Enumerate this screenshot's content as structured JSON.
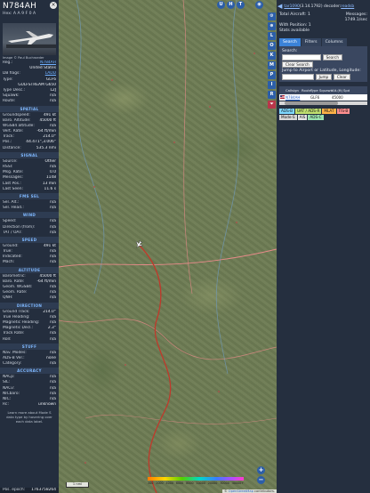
{
  "aircraft": {
    "callsign": "N784AH",
    "hex_line": "Hex: A A 9 F 0 A",
    "close_glyph": "×",
    "photo_credit": "Image © Paul Buchroeder",
    "identity": [
      {
        "k": "Reg.:",
        "v": "N784AH",
        "link": true
      },
      {
        "k": "",
        "v": "United States",
        "link": false
      },
      {
        "k": "DB flags:",
        "v": "LADD",
        "link": true
      },
      {
        "k": "Type:",
        "v": "GLF6",
        "link": false
      },
      {
        "k": "",
        "v": "GULFSTREAM G650",
        "link": false
      },
      {
        "k": "Type Desc.:",
        "v": "L2J",
        "link": false
      },
      {
        "k": "Squawk:",
        "v": "n/a",
        "link": false
      },
      {
        "k": "Route:",
        "v": "n/a",
        "link": false
      }
    ],
    "sections": [
      {
        "title": "SPATIAL",
        "rows": [
          {
            "k": "Groundspeed:",
            "v": "491 kt"
          },
          {
            "k": "Baro. Altitude:",
            "v": "45000 ft"
          },
          {
            "k": "WGS84 altitude:",
            "v": "n/a"
          },
          {
            "k": "Vert. Rate:",
            "v": "-64 ft/min"
          },
          {
            "k": "Track:",
            "v": "214.0°"
          },
          {
            "k": "Pos.:",
            "v": "44.471°,3.006°"
          },
          {
            "k": "Distance:",
            "v": "535.3 nmi"
          }
        ]
      },
      {
        "title": "SIGNAL",
        "rows": [
          {
            "k": "Source:",
            "v": "Other"
          },
          {
            "k": "RSSI:",
            "v": "n/a"
          },
          {
            "k": "Msg. Rate:",
            "v": "0.0"
          },
          {
            "k": "Messages:",
            "v": "1148"
          },
          {
            "k": "Last Pos.:",
            "v": "13 min"
          },
          {
            "k": "Last Seen:",
            "v": "11.6 s"
          }
        ]
      },
      {
        "title": "FMS SEL",
        "rows": [
          {
            "k": "Sel. Alt.:",
            "v": "n/a"
          },
          {
            "k": "Sel. Head.:",
            "v": "n/a"
          }
        ]
      },
      {
        "title": "WIND",
        "rows": [
          {
            "k": "Speed:",
            "v": "n/a"
          },
          {
            "k": "Direction (from):",
            "v": "n/a"
          },
          {
            "k": "TAT / OAT:",
            "v": "n/a"
          }
        ]
      },
      {
        "title": "SPEED",
        "rows": [
          {
            "k": "Ground:",
            "v": "491 kt"
          },
          {
            "k": "True:",
            "v": "n/a"
          },
          {
            "k": "Indicated:",
            "v": "n/a"
          },
          {
            "k": "Mach:",
            "v": "n/a"
          }
        ]
      },
      {
        "title": "ALTITUDE",
        "rows": [
          {
            "k": "Barometric:",
            "v": "45000 ft"
          },
          {
            "k": "Baro. Rate:",
            "v": "-64 ft/min"
          },
          {
            "k": "Geom. WGS84:",
            "v": "n/a"
          },
          {
            "k": "Geom. Rate:",
            "v": "n/a"
          },
          {
            "k": "QNH:",
            "v": "n/a"
          }
        ]
      },
      {
        "title": "DIRECTION",
        "rows": [
          {
            "k": "Ground Track:",
            "v": "214.0°"
          },
          {
            "k": "True Heading:",
            "v": "n/a"
          },
          {
            "k": "Magnetic Heading:",
            "v": "n/a"
          },
          {
            "k": "Magnetic Decl.:",
            "v": "2.3°"
          },
          {
            "k": "Track Rate:",
            "v": "n/a"
          },
          {
            "k": "Roll:",
            "v": "n/a"
          }
        ]
      },
      {
        "title": "STUFF",
        "rows": [
          {
            "k": "Nav. Modes:",
            "v": "n/a"
          },
          {
            "k": "ADS-B Ver.:",
            "v": "none"
          },
          {
            "k": "Category:",
            "v": "n/a"
          }
        ]
      },
      {
        "title": "ACCURACY",
        "rows": [
          {
            "k": "NACp:",
            "v": "n/a"
          },
          {
            "k": "SIL:",
            "v": "n/a"
          },
          {
            "k": "NACv:",
            "v": "n/a"
          },
          {
            "k": "NICbaro:",
            "v": "n/a"
          },
          {
            "k": "NIC:",
            "v": "n/a"
          },
          {
            "k": "Rc:",
            "v": "unknown"
          }
        ]
      }
    ],
    "note": "Learn more about Mode S data type by hovering over each data label.",
    "epoch_label": "Pos. epoch:",
    "epoch_value": "1763758264"
  },
  "map": {
    "top_buttons": [
      "U",
      "H",
      "T"
    ],
    "side_buttons": [
      "L",
      "O",
      "K",
      "M",
      "P",
      "I",
      "R"
    ],
    "zoom_in": "+",
    "zoom_out": "−",
    "scale_label": "1 nmi",
    "legend_ticks": [
      "300",
      "2000",
      "4000",
      "6000",
      "8000",
      "10000",
      "20000",
      "30000",
      "40000+"
    ],
    "attribution_prefix": "© ",
    "attribution_link": "OpenStreetMap",
    "attribution_suffix": " contributors.",
    "colors": {
      "track": "#c0392b",
      "roads": "#e88a8a",
      "aircraft": "#ffffff"
    }
  },
  "right_panel": {
    "toggle_glyph": "◀",
    "version_link": "tar1090",
    "version_text": " (3.14.1792) decoder:",
    "decoder_link": "readsb",
    "stats": [
      {
        "label": "Total Aircraft: 1",
        "value": "Messages:"
      },
      {
        "label": "",
        "value": "1749.1/sec"
      },
      {
        "label": "With Position: 1",
        "value": ""
      },
      {
        "label": "Stats available",
        "value": ""
      }
    ],
    "tabs": [
      "Search",
      "Filters",
      "Columns"
    ],
    "search_label": "Search:",
    "search_button": "Search",
    "clear_search_button": "Clear Search",
    "jump_label": "Jump to Airport or Latitude, Longitude:",
    "jump_button": "Jump",
    "clear_button": "Clear",
    "columns": [
      "",
      "Callsign",
      "Route",
      "Type",
      "Squawk",
      "Alt.(ft)",
      "Spd"
    ],
    "rows": [
      {
        "flag": "us-flag",
        "callsign": "N784AH",
        "route": "",
        "type": "GLF6",
        "squawk": "",
        "alt": "45000",
        "spd": ""
      }
    ],
    "source_legend": [
      {
        "text": "ADS-B",
        "color": "#7fd8ff"
      },
      {
        "text": "UAT / ADS-R",
        "color": "#c0e070"
      },
      {
        "text": "MLAT",
        "color": "#ffb347"
      },
      {
        "text": "TIS-B",
        "color": "#ff8f8f"
      }
    ],
    "source_legend_2": [
      {
        "text": "Mode-S",
        "color": "#d8d8d8"
      },
      {
        "text": "AIS",
        "color": "#e5e5e5"
      },
      {
        "text": "ADS-C",
        "color": "#9ae3b0"
      }
    ]
  }
}
